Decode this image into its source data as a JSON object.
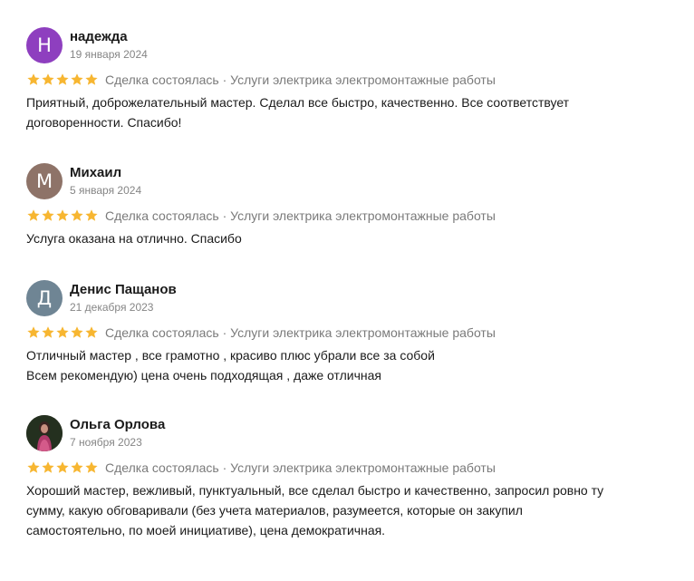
{
  "reviews": [
    {
      "avatar_letter": "Н",
      "avatar_color": "#8e3fbf",
      "avatar_type": "letter",
      "name": "надежда",
      "date": "19 января 2024",
      "rating": 5,
      "deal": "Сделка состоялась · Услуги электрика электромонтажные работы",
      "text": "Приятный, доброжелательный мастер. Сделал все быстро, качественно. Все соответствует\nдоговоренности. Спасибо!"
    },
    {
      "avatar_letter": "М",
      "avatar_color": "#8e7368",
      "avatar_type": "letter",
      "name": "Михаил",
      "date": "5 января 2024",
      "rating": 5,
      "deal": "Сделка состоялась · Услуги электрика электромонтажные работы",
      "text": "Услуга оказана на отлично. Спасибо"
    },
    {
      "avatar_letter": "Д",
      "avatar_color": "#6f8594",
      "avatar_type": "letter",
      "name": "Денис Пащанов",
      "date": "21 декабря 2023",
      "rating": 5,
      "deal": "Сделка состоялась · Услуги электрика электромонтажные работы",
      "text": "Отличный мастер , все грамотно , красиво плюс убрали все за собой\nВсем рекомендую) цена очень подходящая , даже отличная"
    },
    {
      "avatar_letter": "",
      "avatar_color": "#3a2a2a",
      "avatar_type": "photo",
      "name": "Ольга Орлова",
      "date": "7 ноября 2023",
      "rating": 5,
      "deal": "Сделка состоялась · Услуги электрика электромонтажные работы",
      "text": "Хороший мастер, вежливый, пунктуальный, все сделал быстро и качественно, запросил ровно ту\nсумму, какую обговаривали (без учета материалов, разумеется, которые он закупил\nсамостоятельно, по моей инициативе), цена демократичная."
    }
  ],
  "star_color": "#f7b631",
  "star_icon": "star-icon"
}
